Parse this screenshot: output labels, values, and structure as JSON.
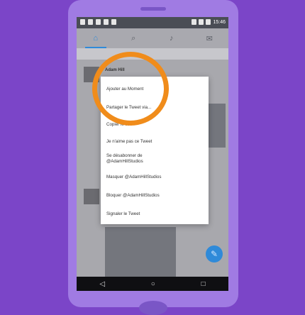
{
  "status": {
    "time": "15:46"
  },
  "tabs": [
    {
      "icon": "home-icon",
      "glyph": "⌂"
    },
    {
      "icon": "search-icon",
      "glyph": "⌕"
    },
    {
      "icon": "notifications-icon",
      "glyph": "♪"
    },
    {
      "icon": "messages-icon",
      "glyph": "✉"
    }
  ],
  "feed": {
    "author": "Adam Hill"
  },
  "menu": {
    "items": [
      "Ajouter au Moment",
      "Partager le Tweet via...",
      "Copier le lien",
      "Je n'aime pas ce Tweet",
      "Se désabonner de",
      "@AdamHillStudios",
      "Masquer @AdamHillStudios",
      "Bloquer @AdamHillStudios",
      "Signaler le Tweet"
    ]
  },
  "nav": {
    "back": "◁",
    "home": "○",
    "recents": "□"
  },
  "fab": {
    "glyph": "✎"
  },
  "colors": {
    "highlight": "#f08c1b",
    "accent": "#2f8ad9",
    "background": "#7b45c8"
  }
}
